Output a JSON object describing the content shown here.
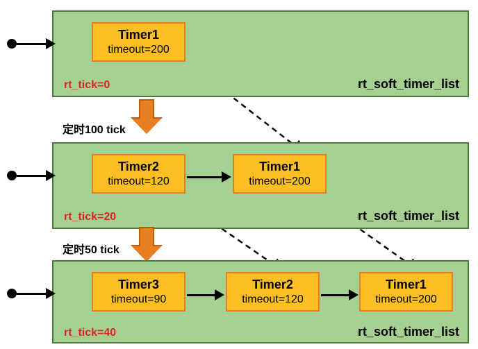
{
  "panels": [
    {
      "rt_tick": "rt_tick=0",
      "list_label": "rt_soft_timer_list",
      "timers": [
        {
          "name": "Timer1",
          "timeout": "timeout=200"
        }
      ]
    },
    {
      "rt_tick": "rt_tick=20",
      "list_label": "rt_soft_timer_list",
      "timers": [
        {
          "name": "Timer2",
          "timeout": "timeout=120"
        },
        {
          "name": "Timer1",
          "timeout": "timeout=200"
        }
      ]
    },
    {
      "rt_tick": "rt_tick=40",
      "list_label": "rt_soft_timer_list",
      "timers": [
        {
          "name": "Timer3",
          "timeout": "timeout=90"
        },
        {
          "name": "Timer2",
          "timeout": "timeout=120"
        },
        {
          "name": "Timer1",
          "timeout": "timeout=200"
        }
      ]
    }
  ],
  "steps": [
    {
      "label": "定时100 tick"
    },
    {
      "label": "定时50 tick"
    }
  ],
  "chart_data": {
    "type": "diagram",
    "title": "rt_soft_timer_list insertion over ticks",
    "states": [
      {
        "at_tick": 0,
        "list": [
          {
            "timer": "Timer1",
            "timeout": 200
          }
        ]
      },
      {
        "at_tick": 20,
        "after_step": "定时100 tick",
        "list": [
          {
            "timer": "Timer2",
            "timeout": 120
          },
          {
            "timer": "Timer1",
            "timeout": 200
          }
        ]
      },
      {
        "at_tick": 40,
        "after_step": "定时50 tick",
        "list": [
          {
            "timer": "Timer3",
            "timeout": 90
          },
          {
            "timer": "Timer2",
            "timeout": 120
          },
          {
            "timer": "Timer1",
            "timeout": 200
          }
        ]
      }
    ]
  }
}
